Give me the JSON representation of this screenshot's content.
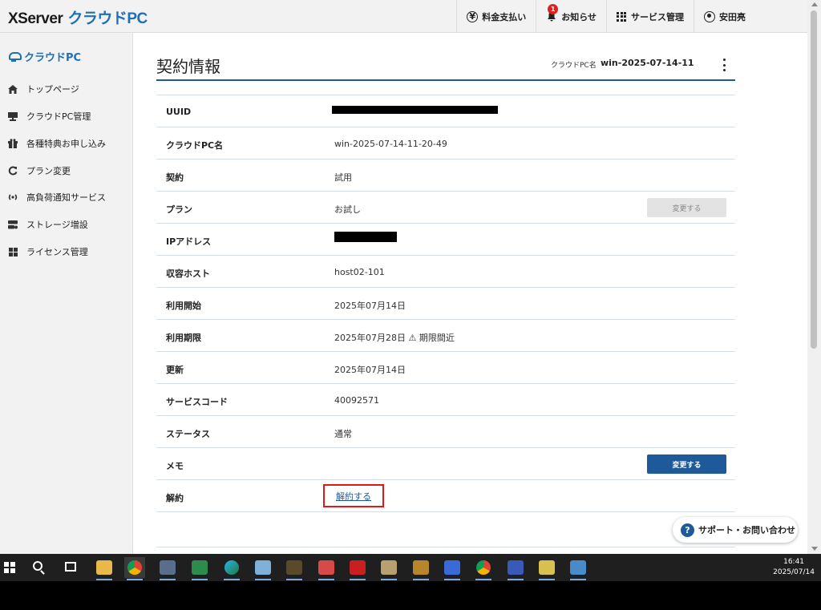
{
  "header": {
    "logo_main": "XServer",
    "logo_sub": "クラウドPC",
    "nav": {
      "billing": "料金支払い",
      "notifications": "お知らせ",
      "notification_count": "1",
      "services": "サービス管理",
      "user": "安田亮"
    }
  },
  "sidebar": {
    "title": "クラウドPC",
    "items": [
      {
        "label": "トップページ",
        "icon": "home-icon"
      },
      {
        "label": "クラウドPC管理",
        "icon": "server-icon"
      },
      {
        "label": "各種特典お申し込み",
        "icon": "gift-icon"
      },
      {
        "label": "プラン変更",
        "icon": "refresh-icon"
      },
      {
        "label": "高負荷通知サービス",
        "icon": "broadcast-icon"
      },
      {
        "label": "ストレージ増設",
        "icon": "storage-icon"
      },
      {
        "label": "ライセンス管理",
        "icon": "windows-icon"
      }
    ]
  },
  "main": {
    "title": "契約情報",
    "pcname_label": "クラウドPC名",
    "pcname_value": "win-2025-07-14-11",
    "rows": [
      {
        "label": "UUID",
        "value": ""
      },
      {
        "label": "クラウドPC名",
        "value": "win-2025-07-14-11-20-49"
      },
      {
        "label": "契約",
        "value": "試用"
      },
      {
        "label": "プラン",
        "value": "お試し",
        "button": "変更する"
      },
      {
        "label": "IPアドレス",
        "value": ""
      },
      {
        "label": "収容ホスト",
        "value": "host02-101"
      },
      {
        "label": "利用開始",
        "value": "2025年07月14日"
      },
      {
        "label": "利用期限",
        "value": "2025年07月28日 ⚠ 期限間近"
      },
      {
        "label": "更新",
        "value": "2025年07月14日"
      },
      {
        "label": "サービスコード",
        "value": "40092571"
      },
      {
        "label": "ステータス",
        "value": "通常"
      },
      {
        "label": "メモ",
        "value": "",
        "button": "変更する"
      },
      {
        "label": "解約",
        "link": "解約する"
      }
    ]
  },
  "support_button": "サポート・お問い合わせ",
  "taskbar": {
    "time": "16:41",
    "date": "2025/07/14"
  },
  "colors": {
    "accent": "#1e5a9a",
    "brand_blue": "#1e6fb5",
    "warning": "#e8901c",
    "highlight_red": "#e01818"
  }
}
